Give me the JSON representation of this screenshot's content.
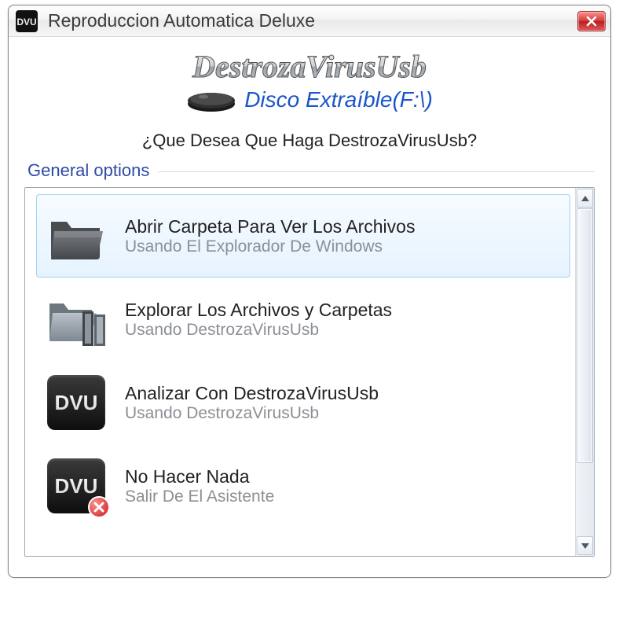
{
  "titlebar": {
    "title": "Reproduccion Automatica Deluxe"
  },
  "header": {
    "logo_text": "DestrozaVirusUsb",
    "disk_label": "Disco Extraíble(F:\\)",
    "prompt": "¿Que Desea Que Haga DestrozaVirusUsb?"
  },
  "group": {
    "label": "General options"
  },
  "options": [
    {
      "icon": "folder-dark",
      "title": "Abrir Carpeta Para Ver Los Archivos",
      "subtitle": "Usando El Explorador De Windows",
      "selected": true
    },
    {
      "icon": "folder-stack",
      "title": "Explorar Los Archivos y Carpetas",
      "subtitle": "Usando DestrozaVirusUsb",
      "selected": false
    },
    {
      "icon": "dvu-chip",
      "title": "Analizar Con DestrozaVirusUsb",
      "subtitle": "Usando DestrozaVirusUsb",
      "selected": false
    },
    {
      "icon": "dvu-chip-close",
      "title": "No Hacer Nada",
      "subtitle": "Salir De El Asistente",
      "selected": false
    }
  ]
}
